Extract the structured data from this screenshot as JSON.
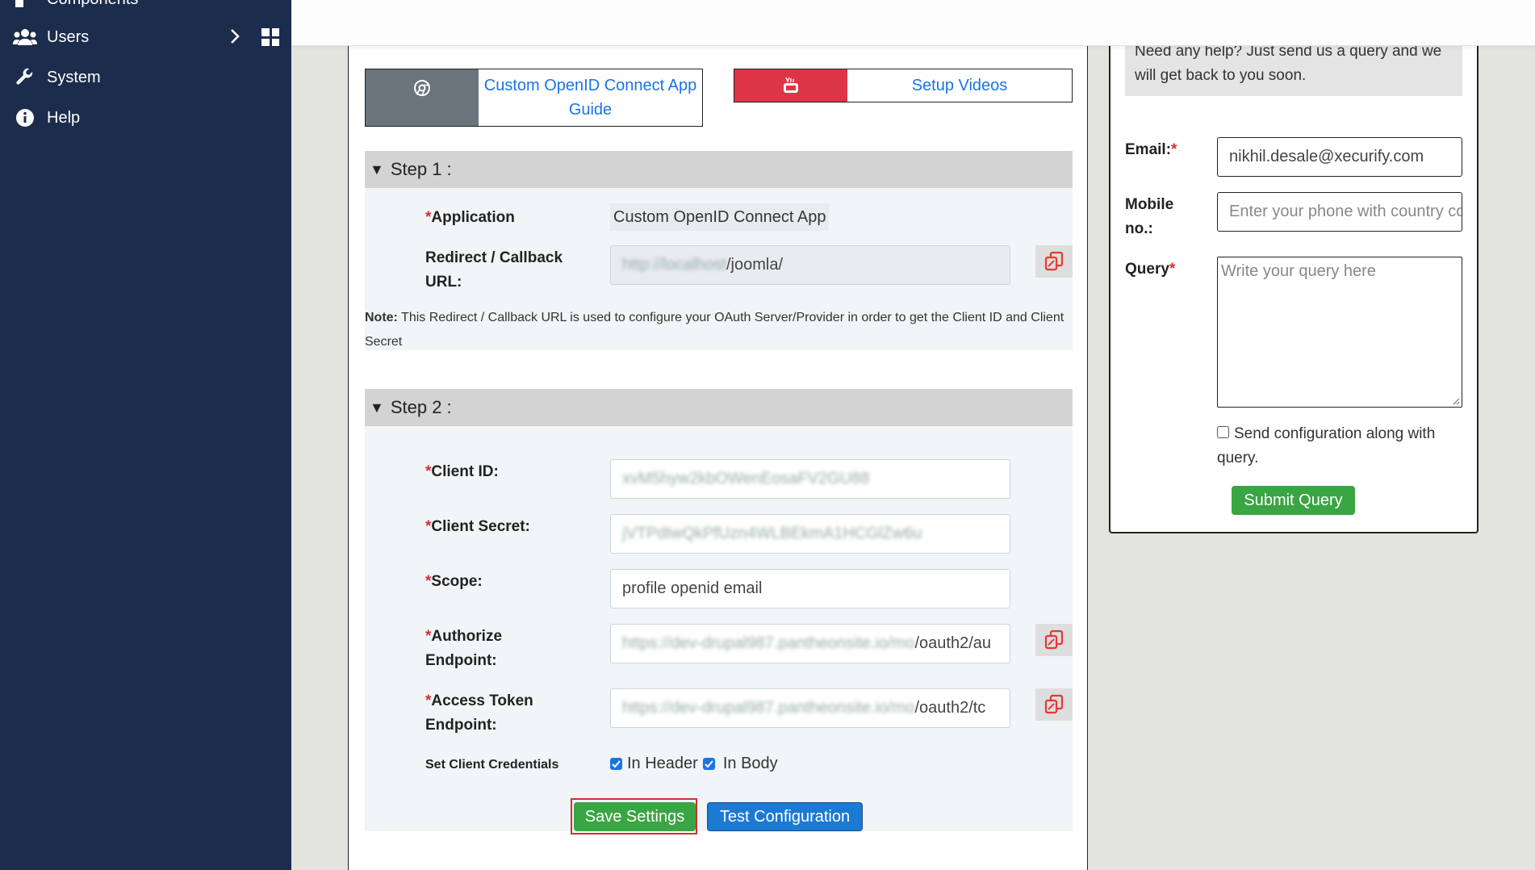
{
  "sidebar": {
    "partial_item": "Components",
    "items": [
      {
        "label": "Users",
        "icon": "users-icon"
      },
      {
        "label": "System",
        "icon": "wrench-icon"
      },
      {
        "label": "Help",
        "icon": "info-icon"
      }
    ]
  },
  "guides": {
    "app_guide": "Custom OpenID Connect App Guide",
    "videos": "Setup Videos"
  },
  "step1": {
    "title": "Step 1 :",
    "application_label": "Application",
    "application_value": "Custom OpenID Connect App",
    "redirect_label": "Redirect / Callback URL:",
    "redirect_hidden": "http://localhost",
    "redirect_visible": "/joomla/",
    "note_prefix": "Note:",
    "note_text": "This Redirect / Callback URL is used to configure your OAuth Server/Provider in order to get the Client ID and Client Secret"
  },
  "step2": {
    "title": "Step 2 :",
    "client_id_label": "Client ID:",
    "client_id_value": "xvM5hyw2kbOWenEosaFV2GU88",
    "client_secret_label": "Client Secret:",
    "client_secret_value": "jVTPdIwQkPfUzn4WLBEkmA1HCGlZw6u",
    "scope_label": "Scope:",
    "scope_value": "profile openid email",
    "authorize_label": "Authorize Endpoint:",
    "authorize_hidden": "https://dev-drupal987.pantheonsite.io/mo",
    "authorize_visible": "/oauth2/au",
    "token_label": "Access Token Endpoint:",
    "token_hidden": "https://dev-drupal987.pantheonsite.io/mo",
    "token_visible": "/oauth2/tc",
    "cred_label": "Set Client Credentials",
    "in_header": "In Header",
    "in_body": "In Body"
  },
  "actions": {
    "save": "Save Settings",
    "test": "Test Configuration"
  },
  "support": {
    "help_text": "Need any help? Just send us a query and we will get back to you soon.",
    "email_label": "Email:",
    "email_value": "nikhil.desale@xecurify.com",
    "mobile_label": "Mobile no.:",
    "mobile_placeholder": "Enter your phone with country code",
    "query_label": "Query",
    "query_placeholder": "Write your query here",
    "send_config": "Send configuration along with query.",
    "submit": "Submit Query"
  },
  "colors": {
    "sidebar": "#1c2c4c",
    "link": "#1a73e8",
    "green": "#3aa543",
    "red": "#dc3545",
    "required": "#d32f2f"
  }
}
